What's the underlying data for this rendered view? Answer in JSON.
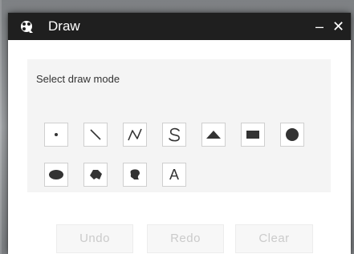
{
  "window": {
    "title": "Draw",
    "minimize_label": "–",
    "close_label": "✕"
  },
  "content": {
    "mode_label": "Select draw mode",
    "tools": [
      {
        "name": "point-tool",
        "icon": "point-icon"
      },
      {
        "name": "line-tool",
        "icon": "line-icon"
      },
      {
        "name": "polyline-tool",
        "icon": "polyline-icon"
      },
      {
        "name": "freehand-polyline-tool",
        "icon": "freehand-line-icon"
      },
      {
        "name": "triangle-tool",
        "icon": "triangle-icon"
      },
      {
        "name": "rectangle-tool",
        "icon": "rectangle-icon"
      },
      {
        "name": "circle-tool",
        "icon": "circle-icon"
      },
      {
        "name": "ellipse-tool",
        "icon": "ellipse-icon"
      },
      {
        "name": "polygon-tool",
        "icon": "polygon-icon"
      },
      {
        "name": "freehand-polygon-tool",
        "icon": "freehand-polygon-icon"
      },
      {
        "name": "text-tool",
        "icon": "text-icon",
        "label": "A"
      }
    ]
  },
  "actions": {
    "undo_label": "Undo",
    "redo_label": "Redo",
    "clear_label": "Clear"
  },
  "colors": {
    "titlebar": "#1f1f1f",
    "icon": "#333333",
    "disabled_text": "#cbcbcb"
  }
}
